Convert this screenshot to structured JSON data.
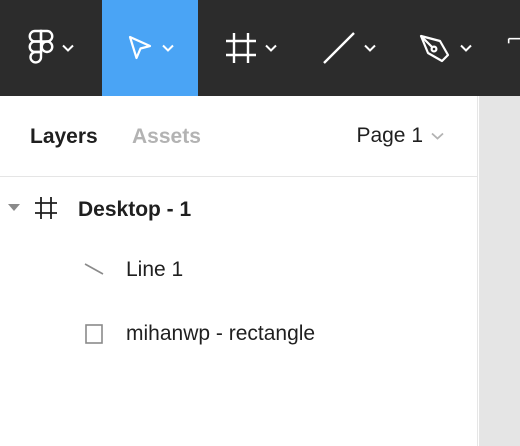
{
  "toolbar": {
    "tools": [
      {
        "icon": "figma-logo-icon",
        "has_dropdown": true,
        "active": false
      },
      {
        "icon": "move-pointer-icon",
        "has_dropdown": true,
        "active": true
      },
      {
        "icon": "frame-icon",
        "has_dropdown": true,
        "active": false
      },
      {
        "icon": "line-icon",
        "has_dropdown": true,
        "active": false
      },
      {
        "icon": "pen-icon",
        "has_dropdown": true,
        "active": false
      },
      {
        "icon": "text-icon",
        "has_dropdown": false,
        "active": false
      }
    ],
    "colors": {
      "background": "#2c2c2c",
      "active": "#4aa4f5",
      "icon": "#ffffff"
    }
  },
  "panel": {
    "tabs": [
      {
        "label": "Layers",
        "active": true
      },
      {
        "label": "Assets",
        "active": false
      }
    ],
    "page_selector": {
      "label": "Page 1"
    },
    "layers": [
      {
        "name": "Desktop - 1",
        "icon": "frame-icon",
        "expanded": true,
        "level": 0
      },
      {
        "name": "Line 1",
        "icon": "line-icon",
        "level": 1
      },
      {
        "name": "mihanwp - rectangle",
        "icon": "rectangle-icon",
        "level": 1
      }
    ]
  }
}
